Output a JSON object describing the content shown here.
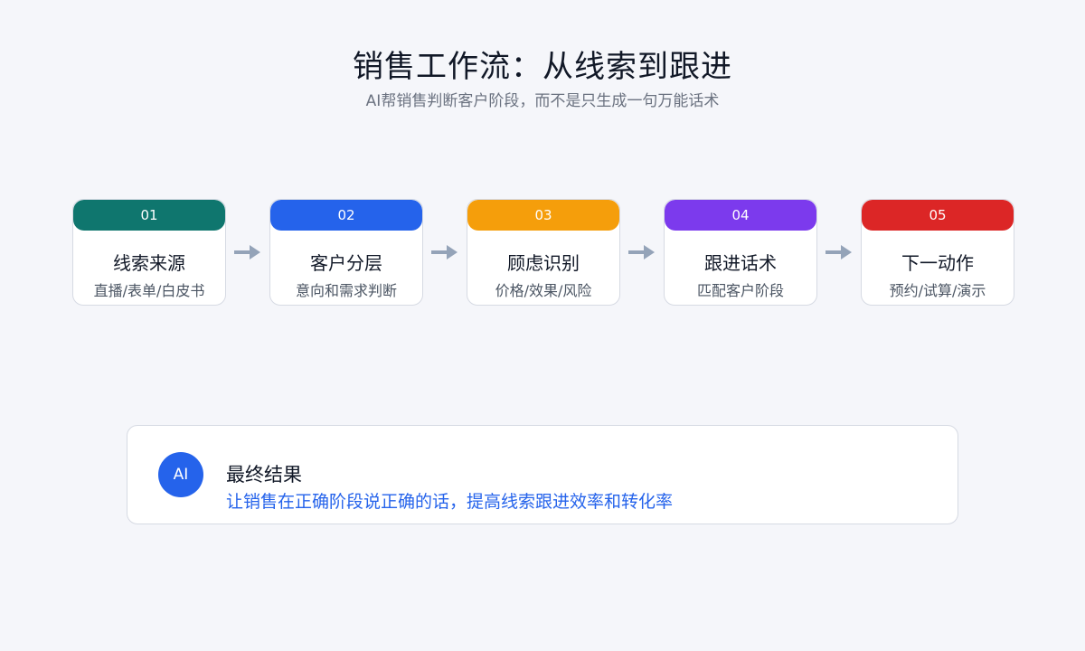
{
  "header": {
    "title": "销售工作流：从线索到跟进",
    "subtitle": "AI帮销售判断客户阶段，而不是只生成一句万能话术"
  },
  "steps": [
    {
      "number": "01",
      "title": "线索来源",
      "desc": "直播/表单/白皮书",
      "color": "#0f766e"
    },
    {
      "number": "02",
      "title": "客户分层",
      "desc": "意向和需求判断",
      "color": "#2563eb"
    },
    {
      "number": "03",
      "title": "顾虑识别",
      "desc": "价格/效果/风险",
      "color": "#f59e0b"
    },
    {
      "number": "04",
      "title": "跟进话术",
      "desc": "匹配客户阶段",
      "color": "#7c3aed"
    },
    {
      "number": "05",
      "title": "下一动作",
      "desc": "预约/试算/演示",
      "color": "#dc2626"
    }
  ],
  "result": {
    "badge": "AI",
    "title": "最终结果",
    "desc": "让销售在正确阶段说正确的话，提高线索跟进效率和转化率"
  }
}
